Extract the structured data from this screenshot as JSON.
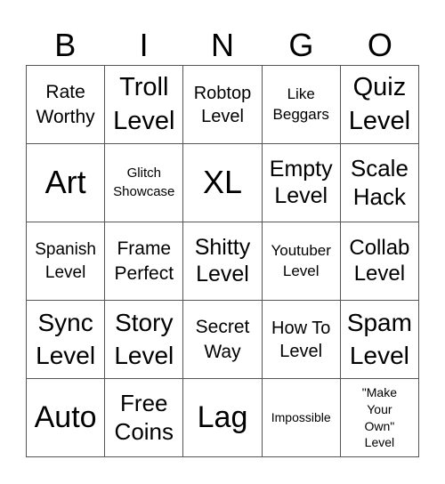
{
  "title_letters": [
    "B",
    "I",
    "N",
    "G",
    "O"
  ],
  "cells": [
    [
      "Rate\nWorthy",
      "Troll\nLevel",
      "Robtop\nLevel",
      "Like\nBeggars",
      "Quiz\nLevel"
    ],
    [
      "Art",
      "Glitch\nShowcase",
      "XL",
      "Empty\nLevel",
      "Scale\nHack"
    ],
    [
      "Spanish\nLevel",
      "Frame\nPerfect",
      "Shitty\nLevel",
      "Youtuber\nLevel",
      "Collab\nLevel"
    ],
    [
      "Sync\nLevel",
      "Story\nLevel",
      "Secret\nWay",
      "How To\nLevel",
      "Spam\nLevel"
    ],
    [
      "Auto",
      "Free\nCoins",
      "Lag",
      "Impossible",
      "\"Make\nYour\nOwn\"\nLevel"
    ]
  ]
}
